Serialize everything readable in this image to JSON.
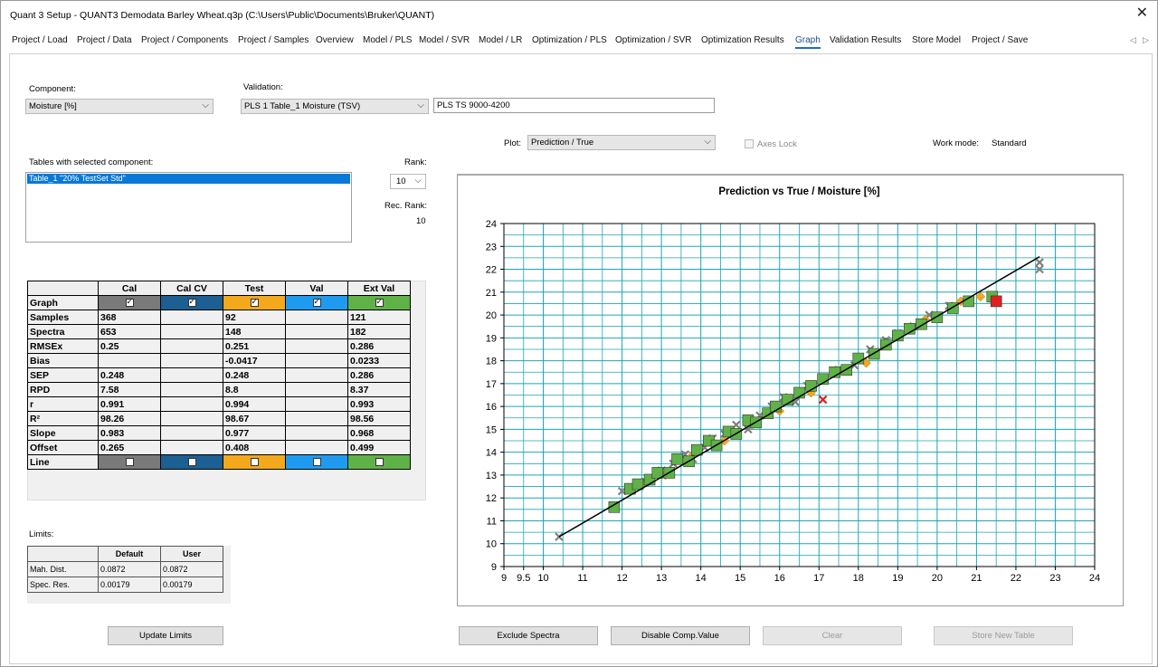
{
  "window": {
    "title": "Quant 3 Setup  -  QUANT3 Demodata Barley Wheat.q3p (C:\\Users\\Public\\Documents\\Bruker\\QUANT)",
    "close_glyph": "✕"
  },
  "tabs": [
    {
      "label": "Project / Load"
    },
    {
      "label": "Project / Data"
    },
    {
      "label": "Project / Components"
    },
    {
      "label": "Project / Samples"
    },
    {
      "label": "Overview"
    },
    {
      "label": "Model / PLS"
    },
    {
      "label": "Model / SVR"
    },
    {
      "label": "Model / LR"
    },
    {
      "label": "Optimization / PLS"
    },
    {
      "label": "Optimization / SVR"
    },
    {
      "label": "Optimization Results"
    },
    {
      "label": "Graph",
      "active": true
    },
    {
      "label": "Validation Results"
    },
    {
      "label": "Store Model"
    },
    {
      "label": "Project / Save"
    }
  ],
  "tab_scroll": {
    "left": "◁",
    "right": "▷"
  },
  "component": {
    "label": "Component:",
    "value": "Moisture [%]"
  },
  "validation": {
    "label": "Validation:",
    "value": "PLS 1 Table_1 Moisture (TSV)",
    "method_text": "PLS TS 9000-4200"
  },
  "plot": {
    "label": "Plot:",
    "value": "Prediction / True",
    "axes_lock_label": "Axes Lock",
    "axes_lock_checked": false
  },
  "work_mode": {
    "label": "Work mode:",
    "value": "Standard"
  },
  "tables": {
    "label": "Tables with selected component:",
    "items": [
      "Table_1   \"20% TestSet Std\""
    ]
  },
  "rank": {
    "label": "Rank:",
    "value": "10",
    "rec_label": "Rec. Rank:",
    "rec_value": "10"
  },
  "stats": {
    "columns": [
      "",
      "Cal",
      "Cal CV",
      "Test",
      "Val",
      "Ext Val"
    ],
    "column_colors": [
      "#7a7a7a",
      "#1c5f93",
      "#f4a81c",
      "#1e9bf0",
      "#5fb247"
    ],
    "graph_label": "Graph",
    "graph_checked": [
      true,
      true,
      true,
      true,
      true
    ],
    "rows": [
      {
        "label": "Samples",
        "cells": [
          "368",
          "",
          "92",
          "",
          "121"
        ]
      },
      {
        "label": "Spectra",
        "cells": [
          "653",
          "",
          "148",
          "",
          "182"
        ]
      },
      {
        "label": "RMSEx",
        "cells": [
          "0.25",
          "",
          "0.251",
          "",
          "0.286"
        ]
      },
      {
        "label": "Bias",
        "cells": [
          "",
          "",
          "-0.0417",
          "",
          "0.0233"
        ]
      },
      {
        "label": "SEP",
        "cells": [
          "0.248",
          "",
          "0.248",
          "",
          "0.286"
        ]
      },
      {
        "label": "RPD",
        "cells": [
          "7.58",
          "",
          "8.8",
          "",
          "8.37"
        ]
      },
      {
        "label": "r",
        "cells": [
          "0.991",
          "",
          "0.994",
          "",
          "0.993"
        ]
      },
      {
        "label": "R²",
        "cells": [
          "98.26",
          "",
          "98.67",
          "",
          "98.56"
        ]
      },
      {
        "label": "Slope",
        "cells": [
          "0.983",
          "",
          "0.977",
          "",
          "0.968"
        ]
      },
      {
        "label": "Offset",
        "cells": [
          "0.265",
          "",
          "0.408",
          "",
          "0.499"
        ]
      }
    ],
    "line_label": "Line",
    "line_checked": [
      false,
      false,
      false,
      false,
      false
    ]
  },
  "limits": {
    "label": "Limits:",
    "columns": [
      "",
      "Default",
      "User"
    ],
    "rows": [
      {
        "label": "Mah. Dist.",
        "default": "0.0872",
        "user": "0.0872"
      },
      {
        "label": "Spec. Res.",
        "default": "0.00179",
        "user": "0.00179"
      }
    ]
  },
  "buttons": {
    "update_limits": "Update Limits",
    "exclude_spectra": "Exclude Spectra",
    "disable_comp": "Disable Comp.Value",
    "clear": "Clear",
    "store_new_table": "Store New Table"
  },
  "colors": {
    "grid": "#1aa6b7",
    "cal_x": "#7f7f7f",
    "test": "#f4a81c",
    "ext": "#5fb247",
    "outlier": "#e02020",
    "accent": "#0a78d7"
  },
  "chart_data": {
    "type": "scatter",
    "title": "Prediction vs True / Moisture [%]",
    "xlabel": "",
    "ylabel": "",
    "xlim": [
      9,
      24
    ],
    "ylim": [
      9,
      24
    ],
    "x_ticks": [
      "9",
      "9.5",
      "10",
      "11",
      "12",
      "13",
      "14",
      "15",
      "16",
      "17",
      "18",
      "19",
      "20",
      "21",
      "22",
      "23",
      "24"
    ],
    "x_tick_values": [
      9,
      9.5,
      10,
      11,
      12,
      13,
      14,
      15,
      16,
      17,
      18,
      19,
      20,
      21,
      22,
      23,
      24
    ],
    "y_ticks": [
      "9",
      "10",
      "11",
      "12",
      "13",
      "14",
      "15",
      "16",
      "17",
      "18",
      "19",
      "20",
      "21",
      "22",
      "23",
      "24"
    ],
    "y_tick_values": [
      9,
      10,
      11,
      12,
      13,
      14,
      15,
      16,
      17,
      18,
      19,
      20,
      21,
      22,
      23,
      24
    ],
    "grid": true,
    "regression_line": {
      "x": [
        10.4,
        22.6
      ],
      "y": [
        10.3,
        22.55
      ]
    },
    "series": [
      {
        "marker": "x",
        "color": "#7f7f7f",
        "x": [
          10.4,
          12.0,
          12.6,
          13.0,
          13.3,
          13.6,
          13.8,
          14.1,
          14.3,
          14.6,
          14.9,
          15.2,
          15.5,
          15.8,
          16.1,
          16.4,
          16.7,
          17.1,
          17.5,
          17.9,
          18.3,
          18.7,
          19.0,
          19.4,
          19.8,
          20.3,
          22.6,
          22.6
        ],
        "y": [
          10.3,
          12.3,
          12.7,
          13.2,
          13.5,
          13.9,
          13.7,
          14.2,
          14.6,
          14.8,
          15.2,
          15.0,
          15.6,
          16.0,
          16.4,
          16.2,
          16.9,
          17.2,
          17.6,
          17.8,
          18.5,
          18.9,
          19.2,
          19.5,
          20.0,
          20.4,
          22.3,
          22.0
        ]
      },
      {
        "marker": "diamond",
        "color": "#f4a81c",
        "x": [
          12.5,
          13.1,
          13.8,
          14.6,
          15.3,
          16.0,
          16.8,
          17.6,
          18.2,
          19.0,
          19.7,
          20.6,
          21.1
        ],
        "y": [
          12.6,
          13.0,
          13.9,
          14.5,
          15.2,
          15.8,
          16.6,
          17.6,
          17.9,
          19.1,
          19.8,
          20.6,
          20.8
        ]
      },
      {
        "marker": "square",
        "color": "#5fb247",
        "x": [
          11.8,
          12.2,
          12.4,
          12.7,
          12.9,
          13.2,
          13.4,
          13.7,
          13.9,
          14.2,
          14.4,
          14.7,
          14.9,
          15.2,
          15.4,
          15.7,
          15.9,
          16.2,
          16.5,
          16.8,
          17.1,
          17.4,
          17.7,
          18.0,
          18.4,
          18.7,
          19.0,
          19.3,
          19.6,
          20.0,
          20.4,
          20.8,
          21.4
        ],
        "y": [
          11.6,
          12.4,
          12.6,
          12.8,
          13.1,
          13.1,
          13.7,
          13.6,
          14.1,
          14.5,
          14.3,
          14.9,
          14.8,
          15.4,
          15.3,
          15.7,
          16.0,
          16.3,
          16.6,
          16.9,
          17.2,
          17.5,
          17.6,
          18.1,
          18.3,
          18.7,
          19.1,
          19.4,
          19.6,
          19.9,
          20.3,
          20.6,
          20.8
        ]
      },
      {
        "marker": "x",
        "color": "#e02020",
        "x": [
          17.1
        ],
        "y": [
          16.3
        ]
      },
      {
        "marker": "square",
        "color": "#e02020",
        "x": [
          21.5
        ],
        "y": [
          20.6
        ]
      }
    ]
  }
}
